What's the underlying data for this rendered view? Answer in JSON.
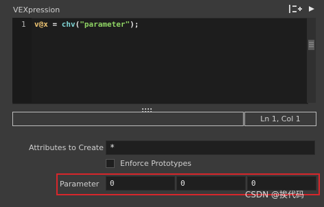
{
  "section": {
    "title": "VEXpression"
  },
  "icons": {
    "node_menu": "add-node-icon",
    "collapse": "collapse-icon"
  },
  "editor": {
    "line_number": "1",
    "code": {
      "var": "v@x",
      "op1": " = ",
      "fn": "chv",
      "paren_open": "(",
      "str": "\"parameter\"",
      "rest": ");"
    },
    "status_left": "",
    "status_right": "Ln 1, Col 1"
  },
  "attributes_to_create": {
    "label": "Attributes to Create",
    "value": "*"
  },
  "enforce_prototypes": {
    "label": "Enforce Prototypes",
    "checked": false
  },
  "parameter": {
    "label": "Parameter",
    "values": [
      "0",
      "0",
      "0"
    ]
  },
  "watermark": {
    "text": "CSDN @挨代码"
  },
  "colors": {
    "highlight": "#d8262b",
    "background": "#3a3a3a",
    "editor_bg": "#1d1d1d"
  }
}
